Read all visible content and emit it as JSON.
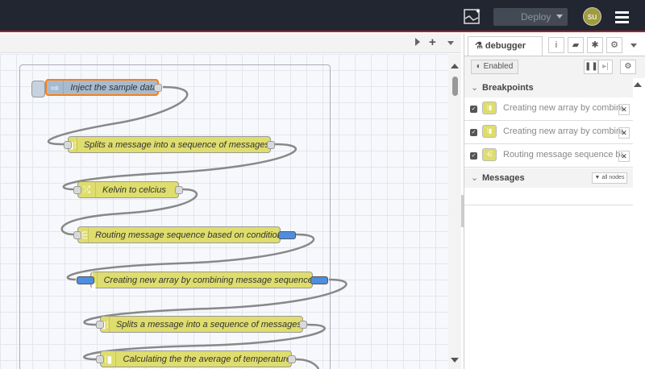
{
  "header": {
    "deploy_label": "Deploy",
    "avatar_initials": "su"
  },
  "sidebar": {
    "tab_label": "debugger",
    "enabled_label": "Enabled",
    "breakpoints_label": "Breakpoints",
    "breakpoints": [
      {
        "label": "Creating new array by combining message sequence",
        "checked": true
      },
      {
        "label": "Creating new array by combining message sequence",
        "checked": true
      },
      {
        "label": "Routing message sequence based on condition",
        "checked": true
      }
    ],
    "messages_label": "Messages",
    "filter_label": "all nodes"
  },
  "flow": {
    "nodes": [
      {
        "label": "Inject the sample data",
        "icon": "arrow-right-icon"
      },
      {
        "label": "Splits a message into a sequence of messages.",
        "icon": "split-icon"
      },
      {
        "label": "Kelvin to celcius",
        "icon": "shuffle-icon"
      },
      {
        "label": "Routing message sequence based on condition",
        "icon": "switch-icon"
      },
      {
        "label": "Creating new array by combining message sequence",
        "icon": "join-icon"
      },
      {
        "label": "Splits a message into a sequence of messages.",
        "icon": "split-icon"
      },
      {
        "label": "Calculating the the average of temperature",
        "icon": "join-icon"
      }
    ]
  },
  "colors": {
    "header": "#212631",
    "node": "#dedd6d",
    "inject": "#a6bbcf",
    "breakpoint": "#4d8ee0",
    "selected": "#ff7f0e"
  }
}
